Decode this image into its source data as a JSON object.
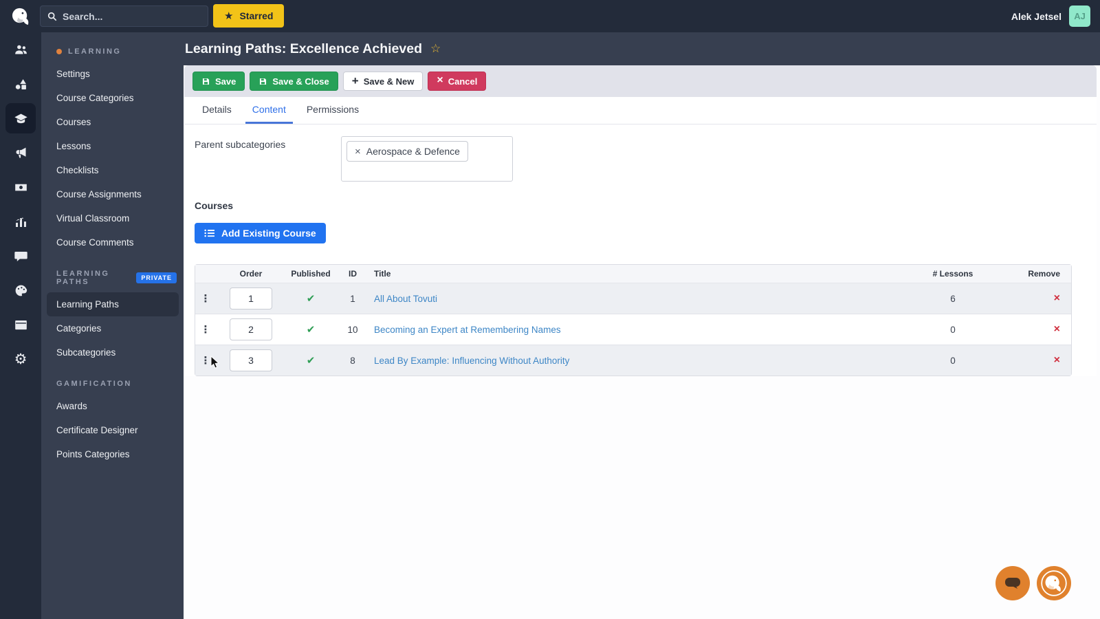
{
  "colors": {
    "topbar": "#232b3a",
    "panel": "#373f50",
    "active_item": "#2a3140",
    "rail_active": "#161d2c",
    "yellow": "#f2c318",
    "green": "#28a158",
    "red": "#d03a5e",
    "blue": "#2173f0",
    "link": "#3d86c6",
    "orange": "#e0812d",
    "badge": "#2572e8",
    "check": "#2f9e55",
    "remove": "#d0303f",
    "mint": "#90e8ca",
    "toolbar": "#e1e2ea"
  },
  "topbar": {
    "search_placeholder": "Search...",
    "starred_label": "Starred",
    "user_name": "Alek Jetsel",
    "avatar_initials": "AJ"
  },
  "sidebar": {
    "rail_icons": [
      "users-icon",
      "shapes-icon",
      "graduation-cap-icon",
      "megaphone-icon",
      "banknote-icon",
      "bar-chart-icon",
      "comment-icon",
      "palette-icon",
      "window-icon",
      "gear-icon"
    ],
    "groups": [
      {
        "header": "LEARNING",
        "dot": true,
        "badge": null,
        "items": [
          "Settings",
          "Course Categories",
          "Courses",
          "Lessons",
          "Checklists",
          "Course Assignments",
          "Virtual Classroom",
          "Course Comments"
        ],
        "active": null
      },
      {
        "header": "LEARNING PATHS",
        "dot": false,
        "badge": "PRIVATE",
        "items": [
          "Learning Paths",
          "Categories",
          "Subcategories"
        ],
        "active": "Learning Paths"
      },
      {
        "header": "GAMIFICATION",
        "dot": false,
        "badge": null,
        "items": [
          "Awards",
          "Certificate Designer",
          "Points Categories"
        ],
        "active": null
      }
    ]
  },
  "page": {
    "title": "Learning Paths: Excellence Achieved"
  },
  "toolbar": {
    "save_label": "Save",
    "save_close_label": "Save & Close",
    "save_new_label": "Save & New",
    "cancel_label": "Cancel"
  },
  "tabs": [
    {
      "label": "Details",
      "active": false
    },
    {
      "label": "Content",
      "active": true
    },
    {
      "label": "Permissions",
      "active": false
    }
  ],
  "form": {
    "parent_subcategories_label": "Parent subcategories",
    "selected_tags": [
      "Aerospace & Defence"
    ],
    "courses_label": "Courses",
    "add_course_label": "Add Existing Course"
  },
  "table": {
    "headers": [
      "Order",
      "Published",
      "ID",
      "Title",
      "# Lessons",
      "Remove"
    ],
    "rows": [
      {
        "order": "1",
        "published": true,
        "id": "1",
        "title": "All About Tovuti",
        "lessons": "6"
      },
      {
        "order": "2",
        "published": true,
        "id": "10",
        "title": "Becoming an Expert at Remembering Names",
        "lessons": "0"
      },
      {
        "order": "3",
        "published": true,
        "id": "8",
        "title": "Lead By Example: Influencing Without Authority",
        "lessons": "0"
      }
    ]
  }
}
